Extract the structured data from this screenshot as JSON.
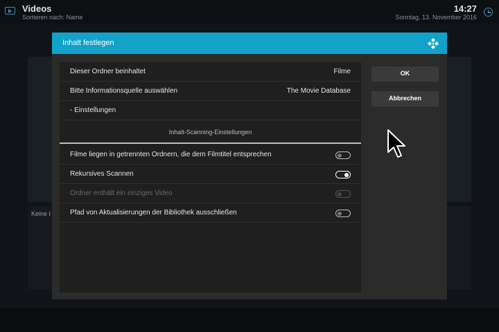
{
  "app": {
    "title": "Videos",
    "sort_label": "Sortieren nach: Name",
    "time": "14:27",
    "date": "Sonntag, 13. November 2016",
    "background_text": "Keine I"
  },
  "dialog": {
    "title": "Inhalt festlegen",
    "rows": [
      {
        "label": "Dieser Ordner beinhaltet",
        "value": "Filme"
      },
      {
        "label": "Bitte Informationsquelle auswählen",
        "value": "The Movie Database"
      },
      {
        "label": "- Einstellungen"
      }
    ],
    "section_header": "Inhalt-Scanning-Einstellungen",
    "toggles": [
      {
        "label": "Filme liegen in getrennten Ordnern, die dem Filmtitel entsprechen",
        "state": "off"
      },
      {
        "label": "Rekursives Scannen",
        "state": "on"
      },
      {
        "label": "Ordner enthält ein einziges Video",
        "state": "disabled"
      },
      {
        "label": "Pfad von Aktualisierungen der Bibliothek ausschließen",
        "state": "off"
      }
    ],
    "ok_label": "OK",
    "cancel_label": "Abbrechen"
  },
  "colors": {
    "accent": "#12a1c9",
    "dialog_bg": "#2b2b2b",
    "panel_bg": "#1f1f1f"
  }
}
